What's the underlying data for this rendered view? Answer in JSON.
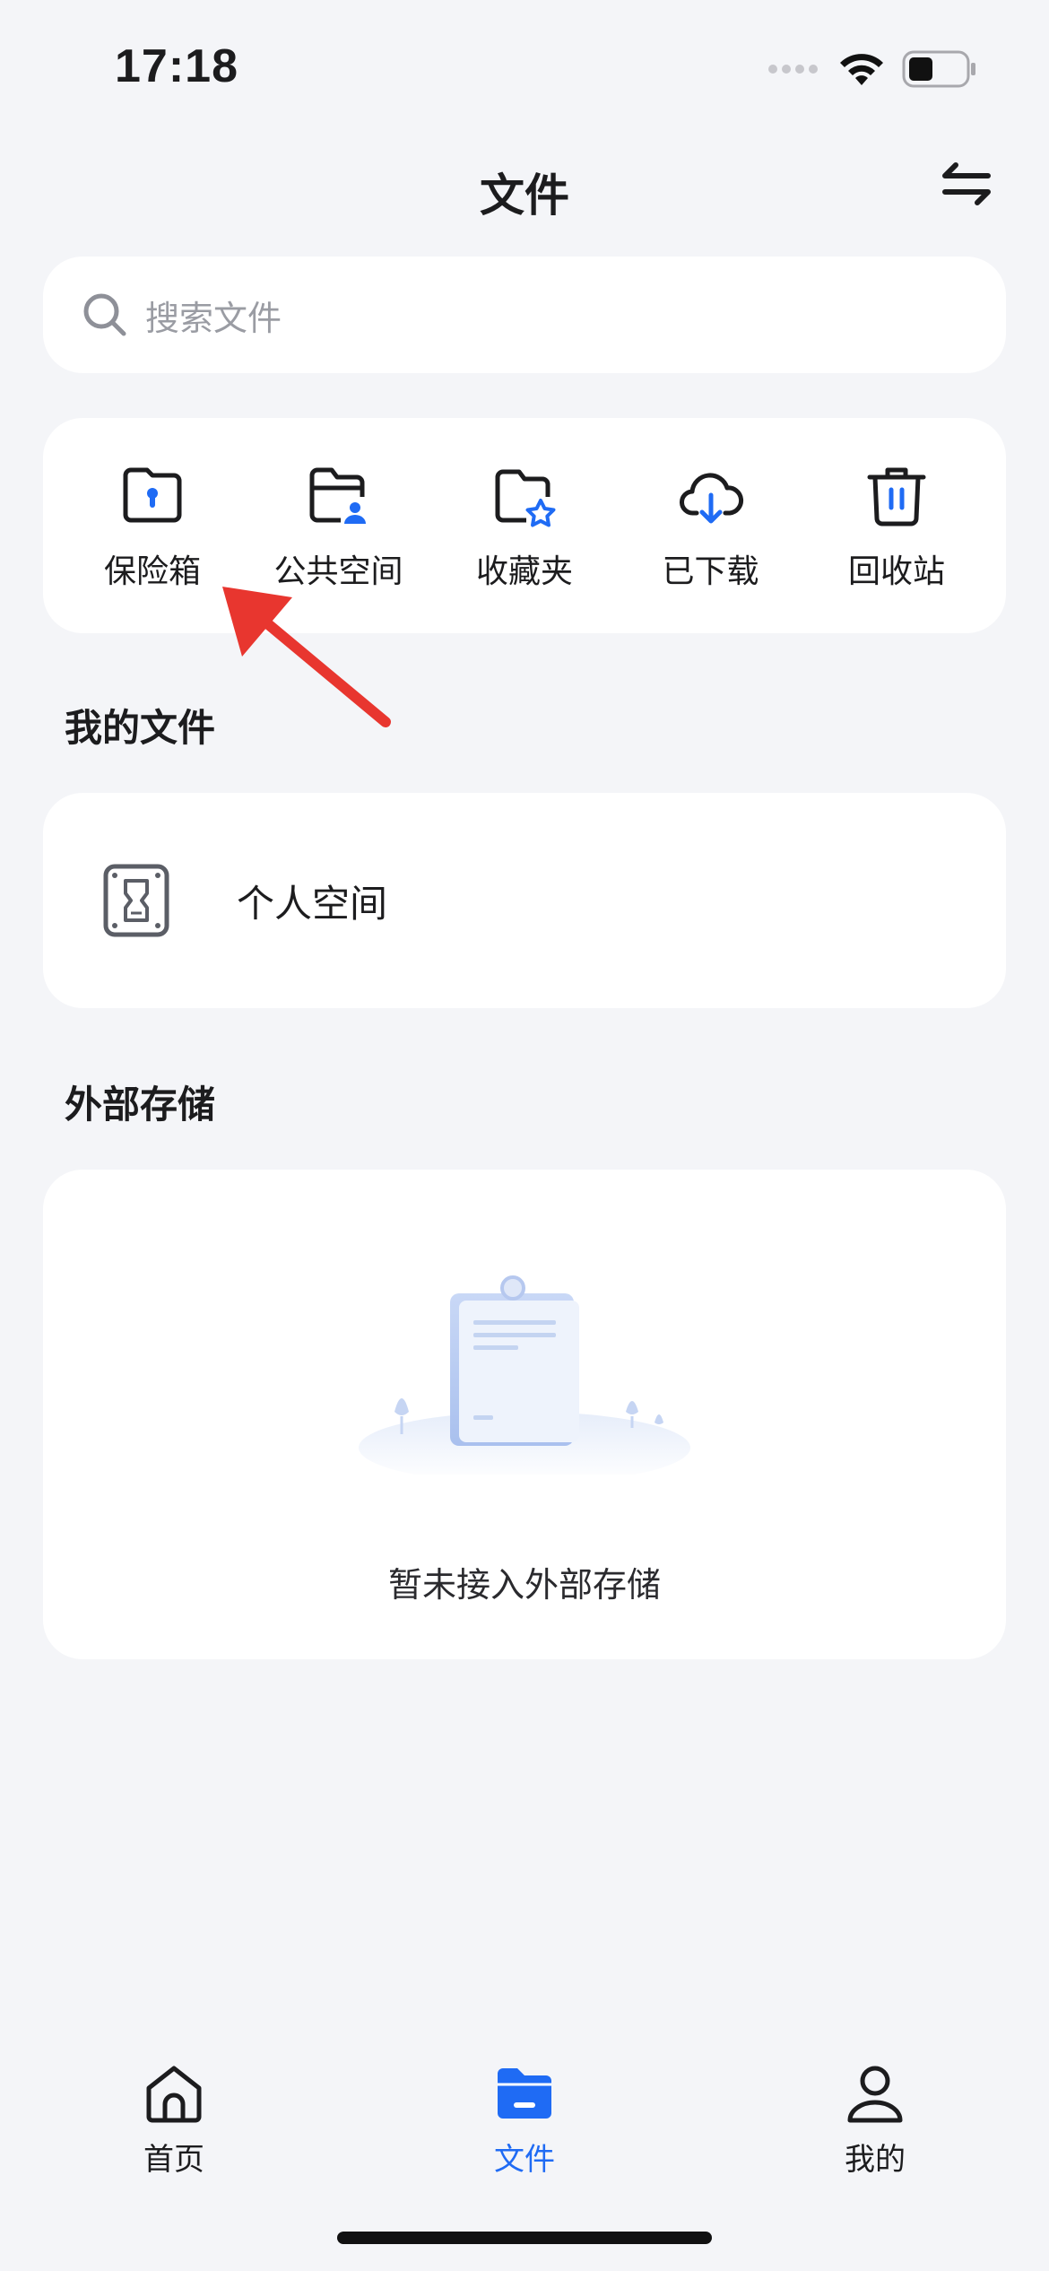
{
  "status_bar": {
    "time": "17:18"
  },
  "header": {
    "title": "文件"
  },
  "search": {
    "placeholder": "搜索文件"
  },
  "quick_actions": [
    {
      "label": "保险箱",
      "icon": "safe-icon"
    },
    {
      "label": "公共空间",
      "icon": "shared-folder-icon"
    },
    {
      "label": "收藏夹",
      "icon": "favorites-folder-icon"
    },
    {
      "label": "已下载",
      "icon": "cloud-download-icon"
    },
    {
      "label": "回收站",
      "icon": "trash-icon"
    }
  ],
  "my_files": {
    "title": "我的文件",
    "item_label": "个人空间"
  },
  "external_storage": {
    "title": "外部存储",
    "empty_text": "暂未接入外部存储"
  },
  "tabbar": {
    "home": "首页",
    "files": "文件",
    "mine": "我的",
    "active": "files"
  },
  "colors": {
    "accent": "#1f6bf4",
    "background": "#f4f5f8",
    "card": "#ffffff",
    "annotation_arrow": "#e8362f"
  }
}
